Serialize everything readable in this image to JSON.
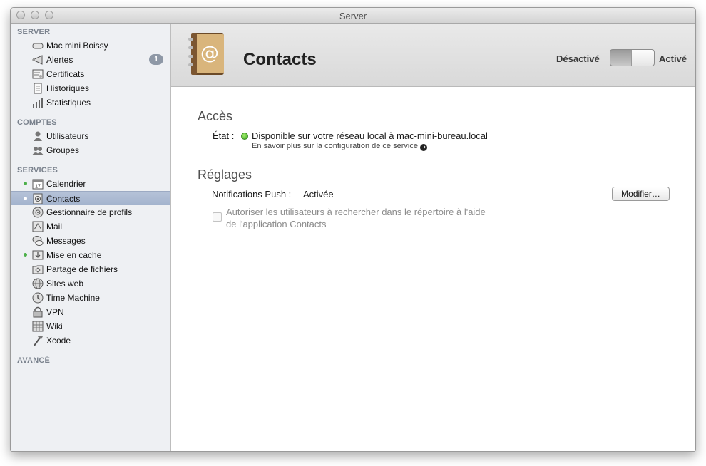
{
  "window": {
    "title": "Server"
  },
  "sidebar": {
    "sections": {
      "server": "SERVER",
      "comptes": "COMPTES",
      "services": "SERVICES",
      "avance": "AVANCÉ"
    },
    "server_items": [
      {
        "label": "Mac mini Boissy",
        "icon": "mac-mini-icon"
      },
      {
        "label": "Alertes",
        "icon": "alerts-icon",
        "badge": "1"
      },
      {
        "label": "Certificats",
        "icon": "certificate-icon"
      },
      {
        "label": "Historiques",
        "icon": "logs-icon"
      },
      {
        "label": "Statistiques",
        "icon": "stats-icon"
      }
    ],
    "account_items": [
      {
        "label": "Utilisateurs",
        "icon": "user-icon"
      },
      {
        "label": "Groupes",
        "icon": "group-icon"
      }
    ],
    "service_items": [
      {
        "label": "Calendrier",
        "icon": "calendar-icon",
        "calendar_day": "17",
        "active": true
      },
      {
        "label": "Contacts",
        "icon": "contacts-icon",
        "active": true,
        "selected": true
      },
      {
        "label": "Gestionnaire de profils",
        "icon": "profile-manager-icon"
      },
      {
        "label": "Mail",
        "icon": "mail-icon"
      },
      {
        "label": "Messages",
        "icon": "messages-icon"
      },
      {
        "label": "Mise en cache",
        "icon": "caching-icon",
        "active": true
      },
      {
        "label": "Partage de fichiers",
        "icon": "file-sharing-icon"
      },
      {
        "label": "Sites web",
        "icon": "websites-icon"
      },
      {
        "label": "Time Machine",
        "icon": "time-machine-icon"
      },
      {
        "label": "VPN",
        "icon": "vpn-icon"
      },
      {
        "label": "Wiki",
        "icon": "wiki-icon"
      },
      {
        "label": "Xcode",
        "icon": "xcode-icon"
      }
    ]
  },
  "header": {
    "title": "Contacts",
    "icon": "address-book-icon",
    "toggle_off_label": "Désactivé",
    "toggle_on_label": "Activé",
    "toggle_state": "on"
  },
  "access": {
    "heading": "Accès",
    "status_label": "État :",
    "status_value": "Disponible sur votre réseau local à mac-mini-bureau.local",
    "status_color": "#4fc22b",
    "learn_more": "En savoir plus sur la configuration de ce service"
  },
  "settings": {
    "heading": "Réglages",
    "push_label": "Notifications Push :",
    "push_value": "Activée",
    "modify_button": "Modifier…",
    "directory_search_label_line1": "Autoriser les utilisateurs à rechercher dans le répertoire à l'aide",
    "directory_search_label_line2": "de l'application Contacts",
    "directory_search_checked": false
  }
}
